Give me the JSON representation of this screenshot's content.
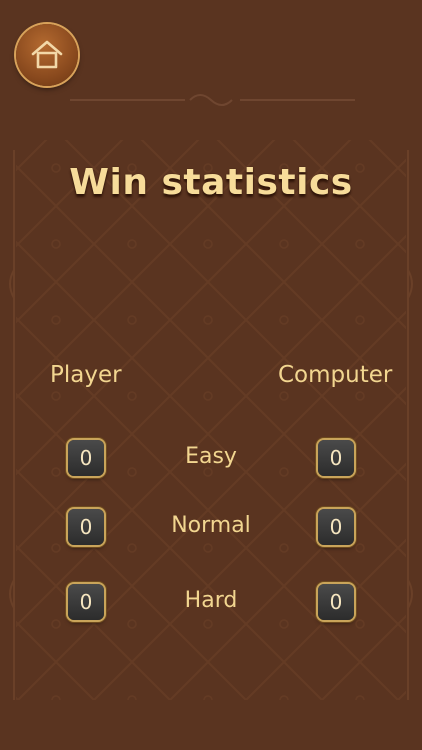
{
  "header": {
    "home_icon": "home-icon"
  },
  "title": "Win statistics",
  "columns": {
    "player": "Player",
    "computer": "Computer"
  },
  "rows": [
    {
      "level": "Easy",
      "player": "0",
      "computer": "0"
    },
    {
      "level": "Normal",
      "player": "0",
      "computer": "0"
    },
    {
      "level": "Hard",
      "player": "0",
      "computer": "0"
    }
  ],
  "colors": {
    "background": "#5a3420",
    "title": "#f7dc9a",
    "text": "#f2d690",
    "score_box": "#3a3a3a",
    "gold_border": "#c9a45a"
  }
}
